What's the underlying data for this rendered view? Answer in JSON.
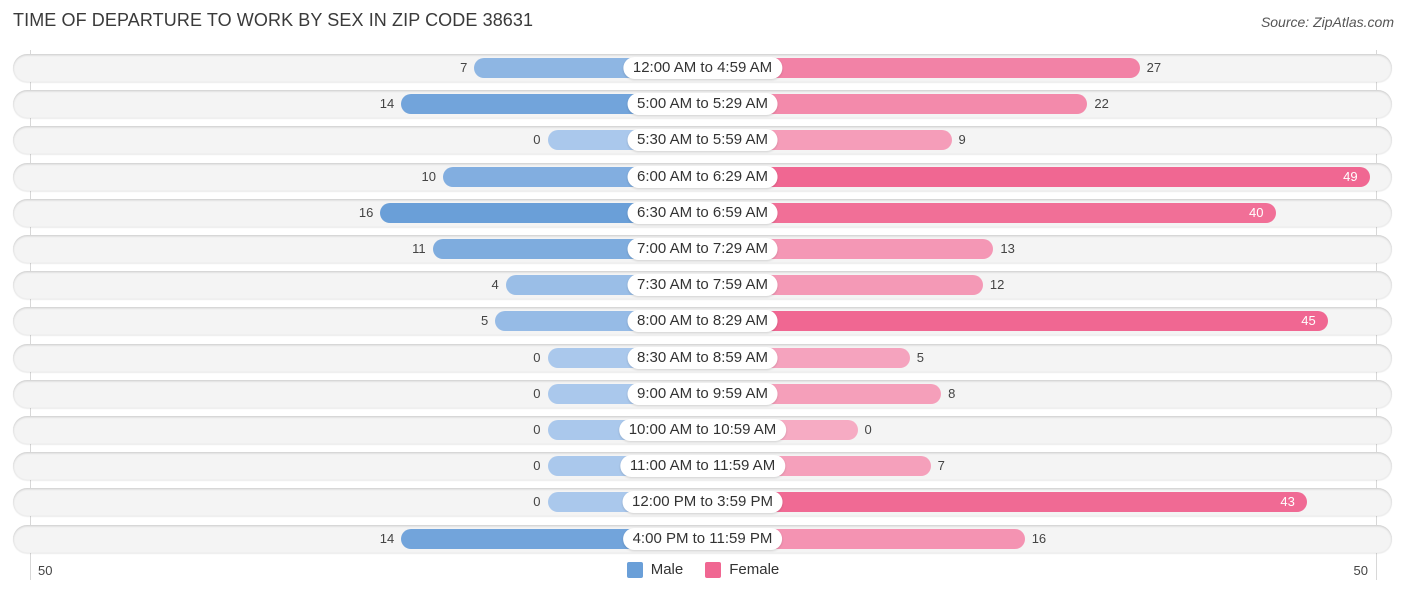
{
  "header": {
    "title": "TIME OF DEPARTURE TO WORK BY SEX IN ZIP CODE 38631",
    "source": "Source: ZipAtlas.com"
  },
  "colors": {
    "male": "#6a9fd8",
    "male_light": "#aac8ec",
    "female": "#f06792",
    "female_light": "#f6abc3"
  },
  "chart_data": {
    "type": "bar",
    "orientation": "horizontal-diverging",
    "title": "TIME OF DEPARTURE TO WORK BY SEX IN ZIP CODE 38631",
    "categories": [
      "12:00 AM to 4:59 AM",
      "5:00 AM to 5:29 AM",
      "5:30 AM to 5:59 AM",
      "6:00 AM to 6:29 AM",
      "6:30 AM to 6:59 AM",
      "7:00 AM to 7:29 AM",
      "7:30 AM to 7:59 AM",
      "8:00 AM to 8:29 AM",
      "8:30 AM to 8:59 AM",
      "9:00 AM to 9:59 AM",
      "10:00 AM to 10:59 AM",
      "11:00 AM to 11:59 AM",
      "12:00 PM to 3:59 PM",
      "4:00 PM to 11:59 PM"
    ],
    "series": [
      {
        "name": "Male",
        "values": [
          7,
          14,
          0,
          10,
          16,
          11,
          4,
          5,
          0,
          0,
          0,
          0,
          0,
          14
        ]
      },
      {
        "name": "Female",
        "values": [
          27,
          22,
          9,
          49,
          40,
          13,
          12,
          45,
          5,
          8,
          0,
          7,
          43,
          16
        ]
      }
    ],
    "axis": {
      "left_tick": "50",
      "right_tick": "50",
      "range": [
        -50,
        50
      ]
    },
    "legend": {
      "position": "bottom-center",
      "entries": [
        "Male",
        "Female"
      ]
    },
    "grid": false
  }
}
